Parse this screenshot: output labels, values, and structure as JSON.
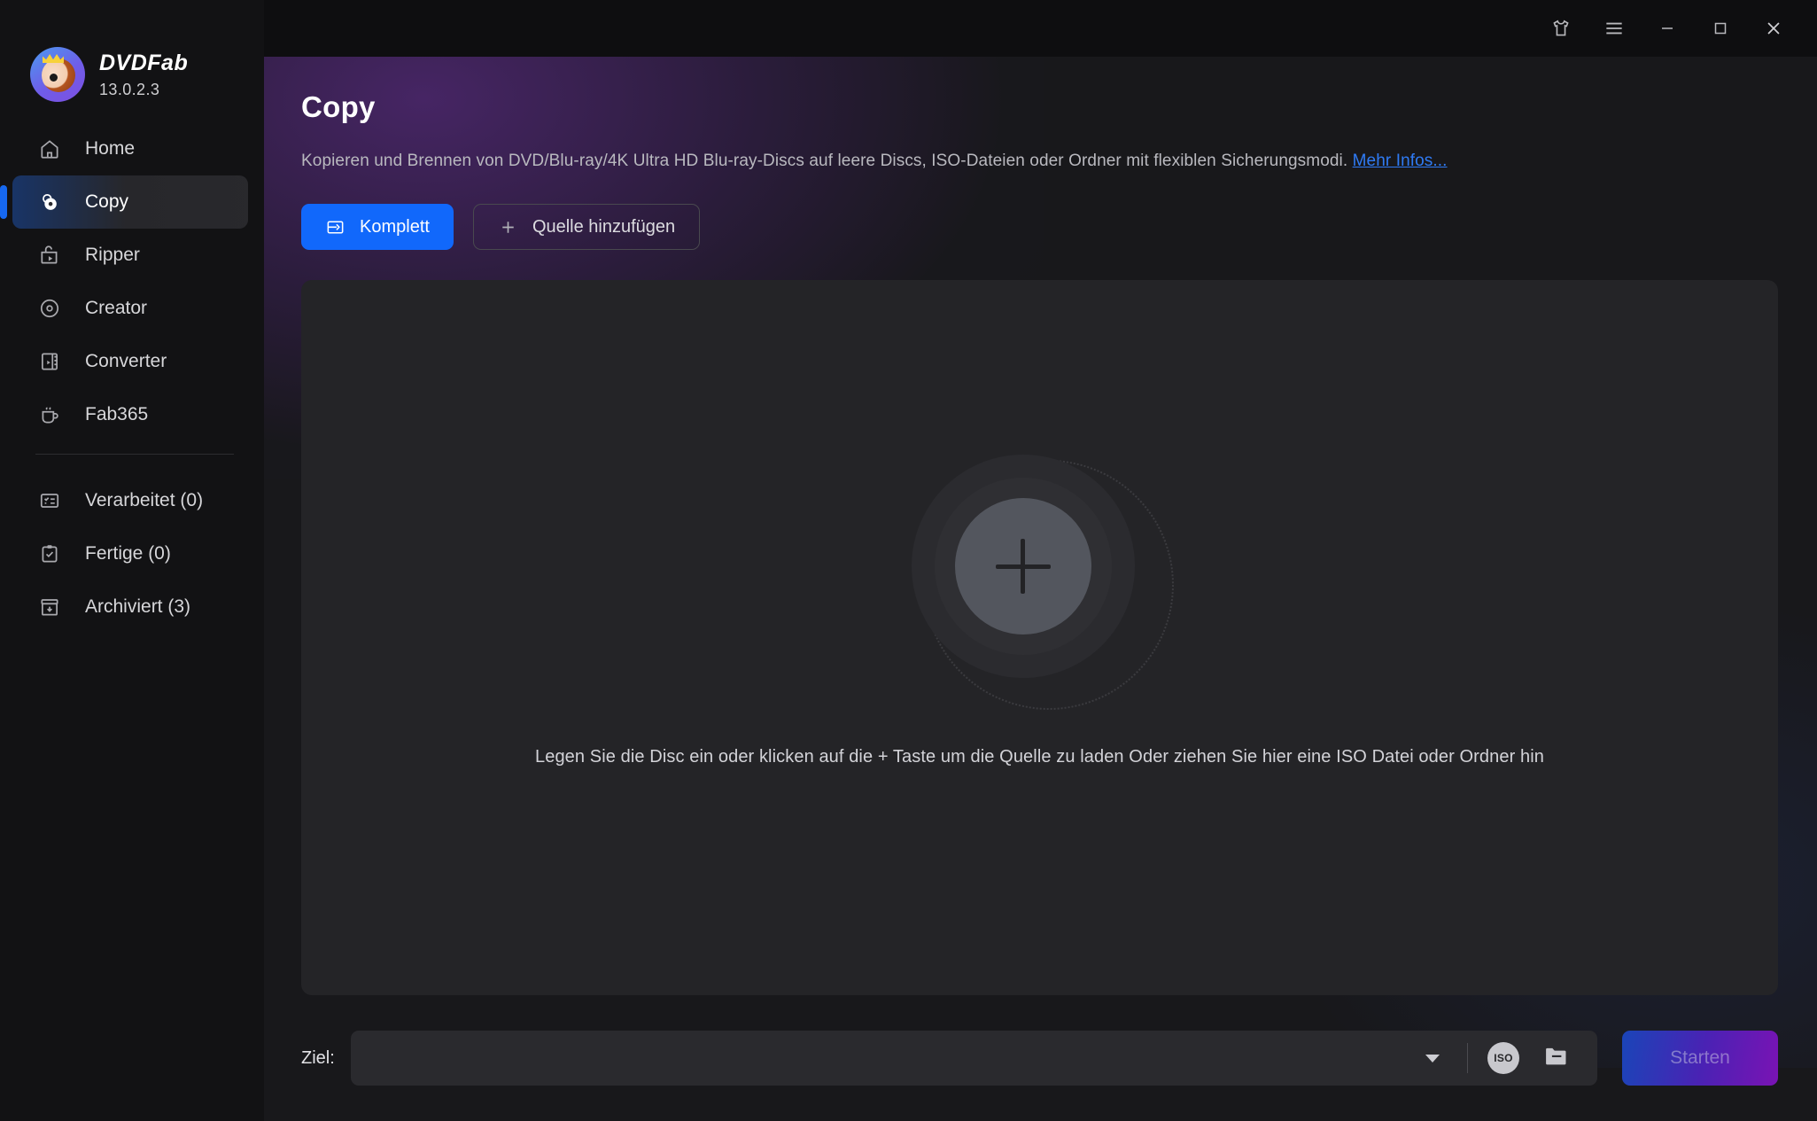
{
  "brand": {
    "name": "DVDFab",
    "version": "13.0.2.3"
  },
  "titlebar": {
    "theme_label": "Theme",
    "menu_label": "Menu",
    "minimize_label": "Minimize",
    "maximize_label": "Maximize",
    "close_label": "Close"
  },
  "sidebar": {
    "items": [
      {
        "label": "Home",
        "icon": "home-icon",
        "active": false
      },
      {
        "label": "Copy",
        "icon": "disc-copy-icon",
        "active": true
      },
      {
        "label": "Ripper",
        "icon": "ripper-icon",
        "active": false
      },
      {
        "label": "Creator",
        "icon": "creator-disc-icon",
        "active": false
      },
      {
        "label": "Converter",
        "icon": "film-converter-icon",
        "active": false
      },
      {
        "label": "Fab365",
        "icon": "fab365-icon",
        "active": false
      }
    ],
    "status_items": [
      {
        "label": "Verarbeitet (0)",
        "icon": "tasklist-icon"
      },
      {
        "label": "Fertige (0)",
        "icon": "clipboard-check-icon"
      },
      {
        "label": "Archiviert (3)",
        "icon": "archive-box-icon"
      }
    ]
  },
  "main": {
    "title": "Copy",
    "description_before_link": "Kopieren und Brennen von DVD/Blu-ray/4K Ultra HD Blu-ray-Discs auf leere Discs, ISO-Dateien oder Ordner mit flexiblen Sicherungsmodi. ",
    "description_link": "Mehr Infos...",
    "mode_button": "Komplett",
    "add_source_button": "Quelle hinzufügen",
    "dropzone_hint": "Legen Sie die Disc ein oder klicken auf die + Taste um die Quelle zu laden Oder ziehen Sie hier eine ISO Datei oder Ordner hin",
    "plus_button_label": "+"
  },
  "bottombar": {
    "destination_label": "Ziel:",
    "destination_value": "",
    "destination_placeholder": "",
    "iso_icon_label": "ISO",
    "folder_icon_label": "Ordner",
    "start_button": "Starten"
  },
  "colors": {
    "accent_blue": "#1168fb",
    "active_rail": "#1668f0",
    "link_blue": "#2f7bf5",
    "start_gradient_from": "#1a45b8",
    "start_gradient_to": "#7a13b4",
    "sidebar_bg": "#121214",
    "main_bg": "#18181b",
    "panel_bg": "#242427"
  }
}
